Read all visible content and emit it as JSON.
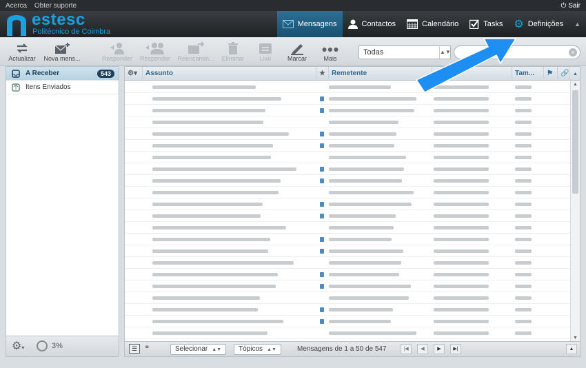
{
  "topbar": {
    "links": [
      "Acerca",
      "Obter suporte"
    ],
    "logout": "Sair"
  },
  "brand": {
    "name": "estesc",
    "subtitle": "Politécnico de Coimbra",
    "color": "#1aa1e2"
  },
  "nav": [
    {
      "label": "Mensagens",
      "icon": "envelope-icon",
      "active": true
    },
    {
      "label": "Contactos",
      "icon": "person-icon",
      "active": false
    },
    {
      "label": "Calendário",
      "icon": "calendar-icon",
      "active": false
    },
    {
      "label": "Tasks",
      "icon": "checkbox-icon",
      "active": false
    },
    {
      "label": "Definições",
      "icon": "gear-icon",
      "active": false
    }
  ],
  "toolbar": {
    "refresh": "Actualizar",
    "compose": "Nova mens...",
    "reply": "Responder",
    "reply_all": "Responder ...",
    "forward": "Reencamin...",
    "delete": "Eliminar",
    "trash": "Lixo",
    "mark": "Marcar",
    "more": "Mais",
    "filter_value": "Todas",
    "search_placeholder": ""
  },
  "folders": [
    {
      "label": "A Receber",
      "count": "543",
      "icon": "inbox-icon",
      "selected": true
    },
    {
      "label": "Itens Enviados",
      "count": "",
      "icon": "sent-icon",
      "selected": false
    }
  ],
  "quota": "3%",
  "list": {
    "columns": {
      "subject": "Assunto",
      "sender": "Remetente",
      "size": "Tam..."
    },
    "select_label": "Selecionar",
    "topics_label": "Tópicos",
    "pager": "Mensagens de 1 a 50 de 547"
  },
  "accent": "#2a6a96"
}
